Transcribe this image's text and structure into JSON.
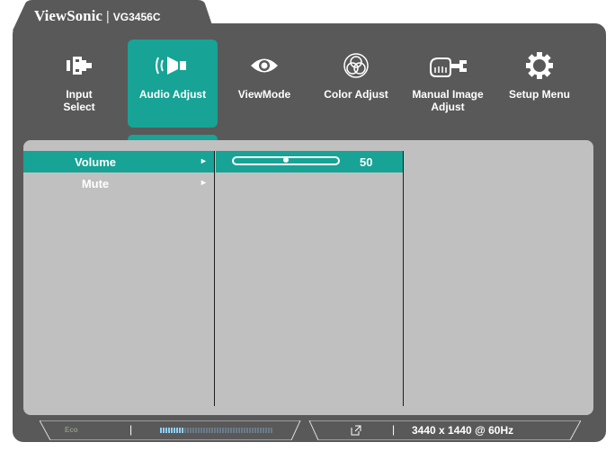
{
  "brand": {
    "name": "ViewSonic",
    "separator": "|",
    "model": "VG3456C"
  },
  "menu": {
    "items": [
      {
        "id": "input-select",
        "label": "Input\nSelect",
        "icon": "input-connector-icon"
      },
      {
        "id": "audio-adjust",
        "label": "Audio Adjust",
        "icon": "speaker-icon",
        "active": true
      },
      {
        "id": "viewmode",
        "label": "ViewMode",
        "icon": "eye-icon"
      },
      {
        "id": "color-adjust",
        "label": "Color Adjust",
        "icon": "color-circles-icon"
      },
      {
        "id": "manual-image-adjust",
        "label": "Manual Image\nAdjust",
        "icon": "hand-wrench-icon"
      },
      {
        "id": "setup-menu",
        "label": "Setup Menu",
        "icon": "gear-icon"
      }
    ]
  },
  "submenu": {
    "items": [
      {
        "label": "Volume",
        "arrow": "►",
        "selected": true
      },
      {
        "label": "Mute",
        "arrow": "►",
        "selected": false
      }
    ]
  },
  "volume": {
    "value": "50",
    "level_fraction": 0.5
  },
  "status": {
    "eco_label": "Eco",
    "separator": "|",
    "resolution": "3440 x 1440 @ 60Hz"
  },
  "colors": {
    "accent": "#17a395",
    "frame": "#595959",
    "panel": "#c0c0c0",
    "text": "#ffffff"
  }
}
